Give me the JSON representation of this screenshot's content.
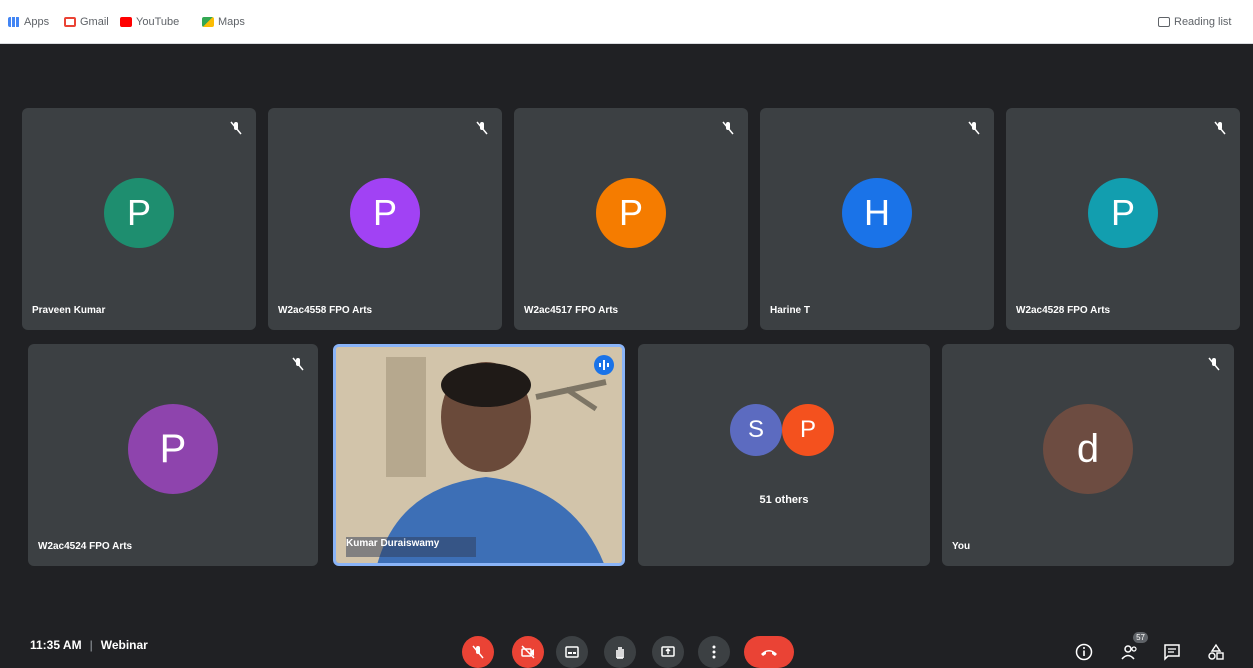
{
  "bookmarks": [
    {
      "label": "Apps",
      "icon": "apps-icon"
    },
    {
      "label": "Gmail",
      "icon": "gmail-icon"
    },
    {
      "label": "YouTube",
      "icon": "youtube-icon"
    },
    {
      "label": "Maps",
      "icon": "maps-icon"
    }
  ],
  "reading_list": {
    "label": "Reading list",
    "icon": "reading-list-icon"
  },
  "participants": [
    {
      "name": "Praveen Kumar",
      "initial": "P",
      "color": "#1e8e6f",
      "muted": true
    },
    {
      "name": "W2ac4558 FPO Arts",
      "initial": "P",
      "color": "#a142f4",
      "muted": true
    },
    {
      "name": "W2ac4517 FPO Arts",
      "initial": "P",
      "color": "#f57c00",
      "muted": true
    },
    {
      "name": "Harine T",
      "initial": "H",
      "color": "#1a73e8",
      "muted": true
    },
    {
      "name": "W2ac4528 FPO Arts",
      "initial": "P",
      "color": "#129eaf",
      "muted": true
    },
    {
      "name": "W2ac4524 FPO Arts",
      "initial": "P",
      "color": "#8e44ad",
      "muted": true
    }
  ],
  "presenter": {
    "name": "Kumar Duraiswamy"
  },
  "others": {
    "label": "51 others",
    "initials": [
      "S",
      "P"
    ],
    "colors": [
      "#5c6bc0",
      "#f4511e"
    ]
  },
  "self": {
    "name": "You",
    "initial": "d",
    "color": "#6d4c41",
    "muted": true
  },
  "bottom": {
    "time": "11:35 AM",
    "separator": "|",
    "meeting_name": "Webinar",
    "participant_count": "57"
  },
  "colors": {
    "accent": "#8ab4f8",
    "danger": "#ea4335",
    "tile": "#3c4043",
    "bg": "#202124"
  }
}
